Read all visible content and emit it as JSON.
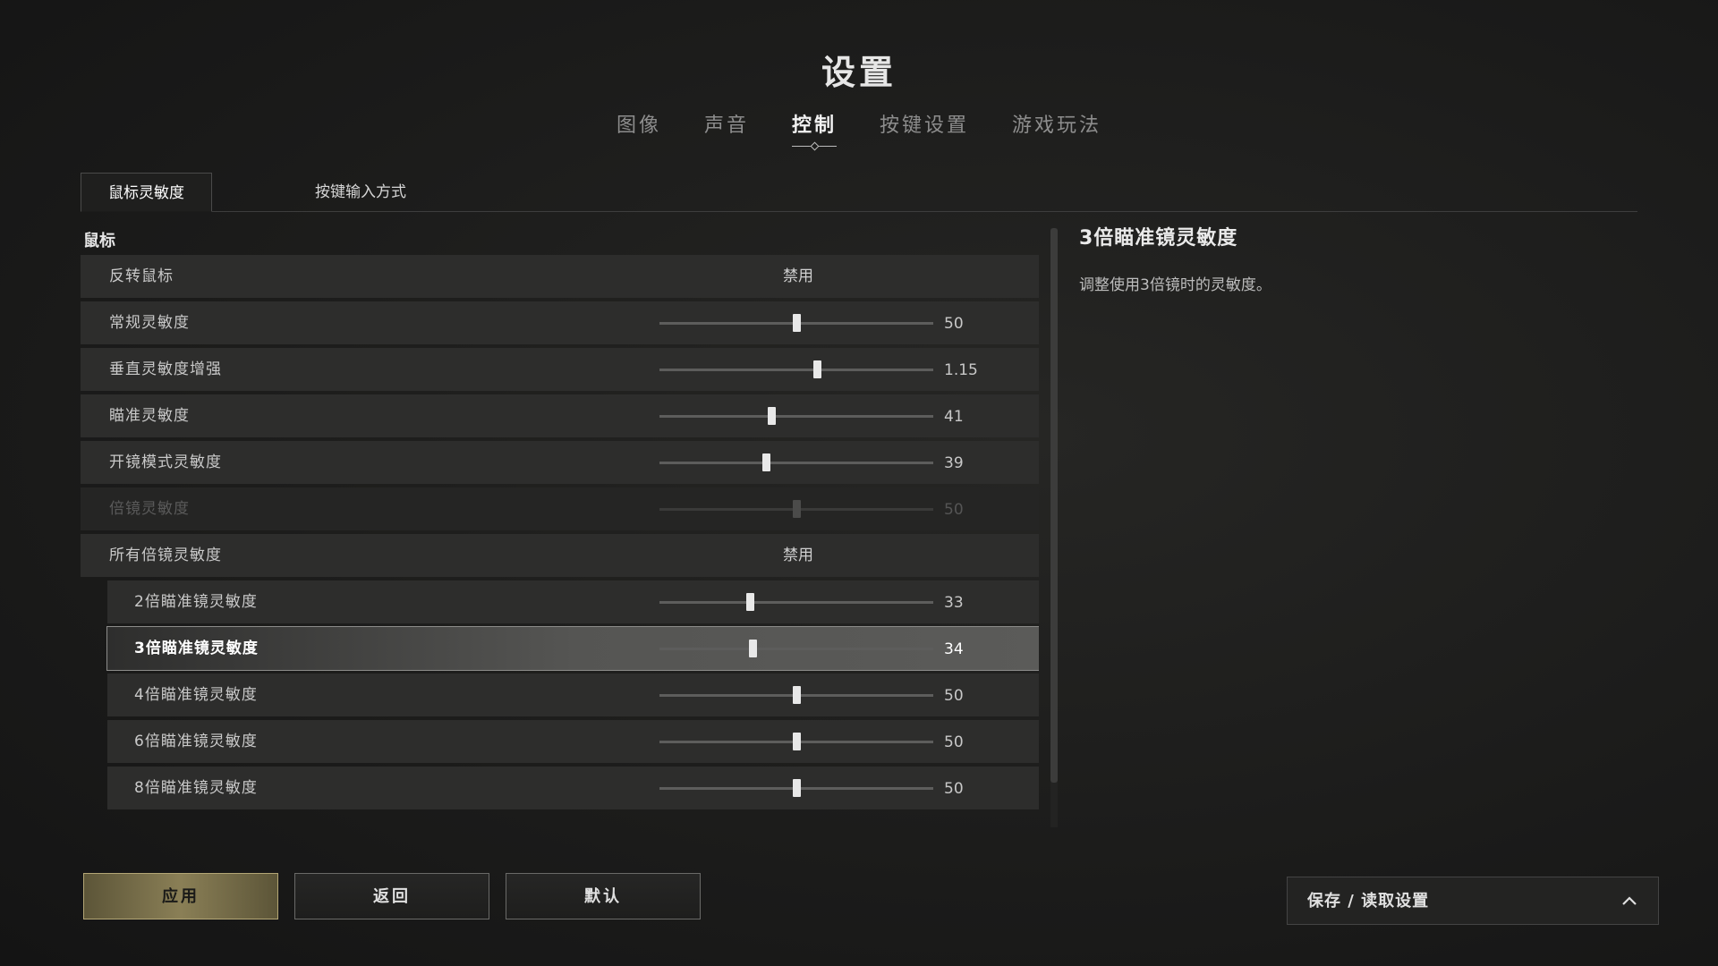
{
  "page_title": "设置",
  "tabs": [
    "图像",
    "声音",
    "控制",
    "按键设置",
    "游戏玩法"
  ],
  "active_tab": "控制",
  "subtabs": [
    "鼠标灵敏度",
    "按键输入方式"
  ],
  "active_subtab": "鼠标灵敏度",
  "section_label": "鼠标",
  "rows": [
    {
      "label": "反转鼠标",
      "type": "toggle",
      "state": "禁用"
    },
    {
      "label": "常规灵敏度",
      "type": "slider",
      "value": "50",
      "fraction": 0.5
    },
    {
      "label": "垂直灵敏度增强",
      "type": "slider",
      "value": "1.15",
      "fraction": 0.575
    },
    {
      "label": "瞄准灵敏度",
      "type": "slider",
      "value": "41",
      "fraction": 0.41
    },
    {
      "label": "开镜模式灵敏度",
      "type": "slider",
      "value": "39",
      "fraction": 0.39
    },
    {
      "label": "倍镜灵敏度",
      "type": "slider",
      "value": "50",
      "fraction": 0.5,
      "disabled": true
    },
    {
      "label": "所有倍镜灵敏度",
      "type": "toggle",
      "state": "禁用"
    },
    {
      "label": "2倍瞄准镜灵敏度",
      "type": "slider",
      "value": "33",
      "fraction": 0.33,
      "sub": true
    },
    {
      "label": "3倍瞄准镜灵敏度",
      "type": "slider",
      "value": "34",
      "fraction": 0.34,
      "sub": true,
      "selected": true
    },
    {
      "label": "4倍瞄准镜灵敏度",
      "type": "slider",
      "value": "50",
      "fraction": 0.5,
      "sub": true
    },
    {
      "label": "6倍瞄准镜灵敏度",
      "type": "slider",
      "value": "50",
      "fraction": 0.5,
      "sub": true
    },
    {
      "label": "8倍瞄准镜灵敏度",
      "type": "slider",
      "value": "50",
      "fraction": 0.5,
      "sub": true
    }
  ],
  "info": {
    "title": "3倍瞄准镜灵敏度",
    "description": "调整使用3倍镜时的灵敏度。"
  },
  "buttons": {
    "apply": "应用",
    "back": "返回",
    "default": "默认"
  },
  "save_load_label": "保存 / 读取设置",
  "icons": {
    "save_load_toggle": "chevron-up-icon"
  },
  "colors": {
    "apply_button": "#8a7f56",
    "selected_row": "#5b5b59"
  }
}
